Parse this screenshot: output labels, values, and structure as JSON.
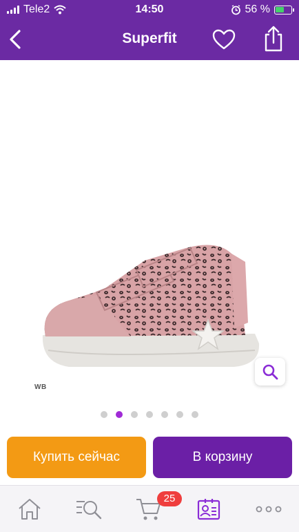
{
  "status_bar": {
    "carrier": "Tele2",
    "time": "14:50",
    "battery_percent": "56 %",
    "battery_level": 0.56,
    "icons": [
      "signal-icon",
      "wifi-icon",
      "alarm-icon",
      "battery-icon"
    ]
  },
  "nav": {
    "title": "Superfit",
    "icons": [
      "back-arrow-icon",
      "heart-icon",
      "share-icon"
    ]
  },
  "product": {
    "image_label": "WB",
    "carousel": {
      "total": 7,
      "active_index": 1
    },
    "zoom_icon": "search-icon"
  },
  "actions": {
    "buy_now": "Купить сейчас",
    "add_to_cart": "В корзину"
  },
  "tabbar": {
    "cart_badge": "25",
    "icons": [
      "home-icon",
      "search-catalog-icon",
      "cart-icon",
      "profile-icon",
      "more-icon"
    ]
  },
  "colors": {
    "brand_purple": "#6b2aa3",
    "cart_button": "#6b1fa6",
    "buy_button": "#f39a14",
    "badge_red": "#ef3e3e",
    "active_dot": "#a02bd6"
  }
}
